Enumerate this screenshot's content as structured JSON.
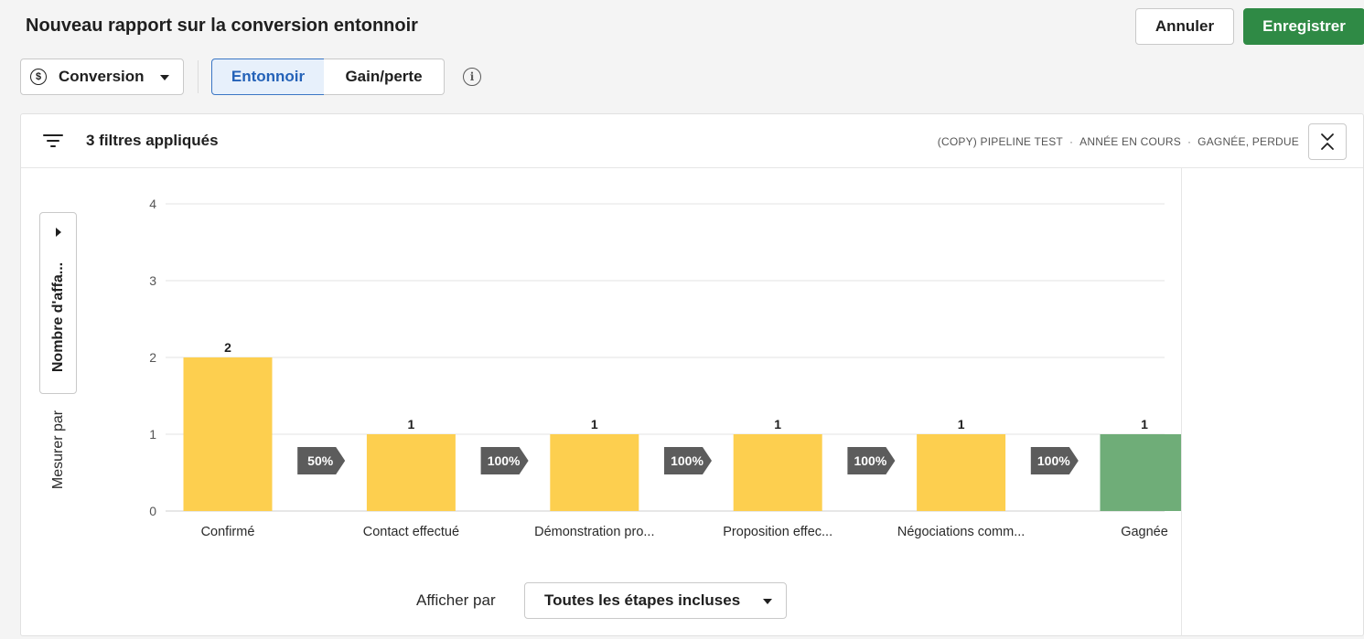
{
  "header": {
    "title": "Nouveau rapport sur la conversion entonnoir",
    "cancel_label": "Annuler",
    "save_label": "Enregistrer"
  },
  "toolbar": {
    "metric_select": "Conversion",
    "view_tabs": [
      {
        "label": "Entonnoir",
        "active": true
      },
      {
        "label": "Gain/perte",
        "active": false
      }
    ]
  },
  "filters": {
    "summary": "3 filtres appliqués",
    "tags": [
      "(COPY) PIPELINE TEST",
      "ANNÉE EN COURS",
      "GAGNÉE, PERDUE"
    ]
  },
  "measure": {
    "label": "Mesurer par",
    "value": "Nombre d'affa..."
  },
  "show_by": {
    "label": "Afficher par",
    "value": "Toutes les étapes incluses"
  },
  "colors": {
    "accent_green": "#2f8a45",
    "accent_blue": "#2462b8",
    "bar_yellow": "#fdcf4f",
    "bar_green": "#6fad78",
    "arrow_gray": "#5c5c5c"
  },
  "chart_data": {
    "type": "bar",
    "categories": [
      "Confirmé",
      "Contact effectué",
      "Démonstration pro...",
      "Proposition effec...",
      "Négociations comm...",
      "Gagnée"
    ],
    "values": [
      2,
      1,
      1,
      1,
      1,
      1
    ],
    "data_labels": [
      "2",
      "1",
      "1",
      "1",
      "1",
      "1"
    ],
    "conversion_rates": [
      "50%",
      "100%",
      "100%",
      "100%",
      "100%"
    ],
    "ylim": [
      0,
      4
    ],
    "yticks": [
      0,
      1,
      2,
      3,
      4
    ],
    "grid": true,
    "bar_colors": [
      "#fdcf4f",
      "#fdcf4f",
      "#fdcf4f",
      "#fdcf4f",
      "#fdcf4f",
      "#6fad78"
    ]
  }
}
